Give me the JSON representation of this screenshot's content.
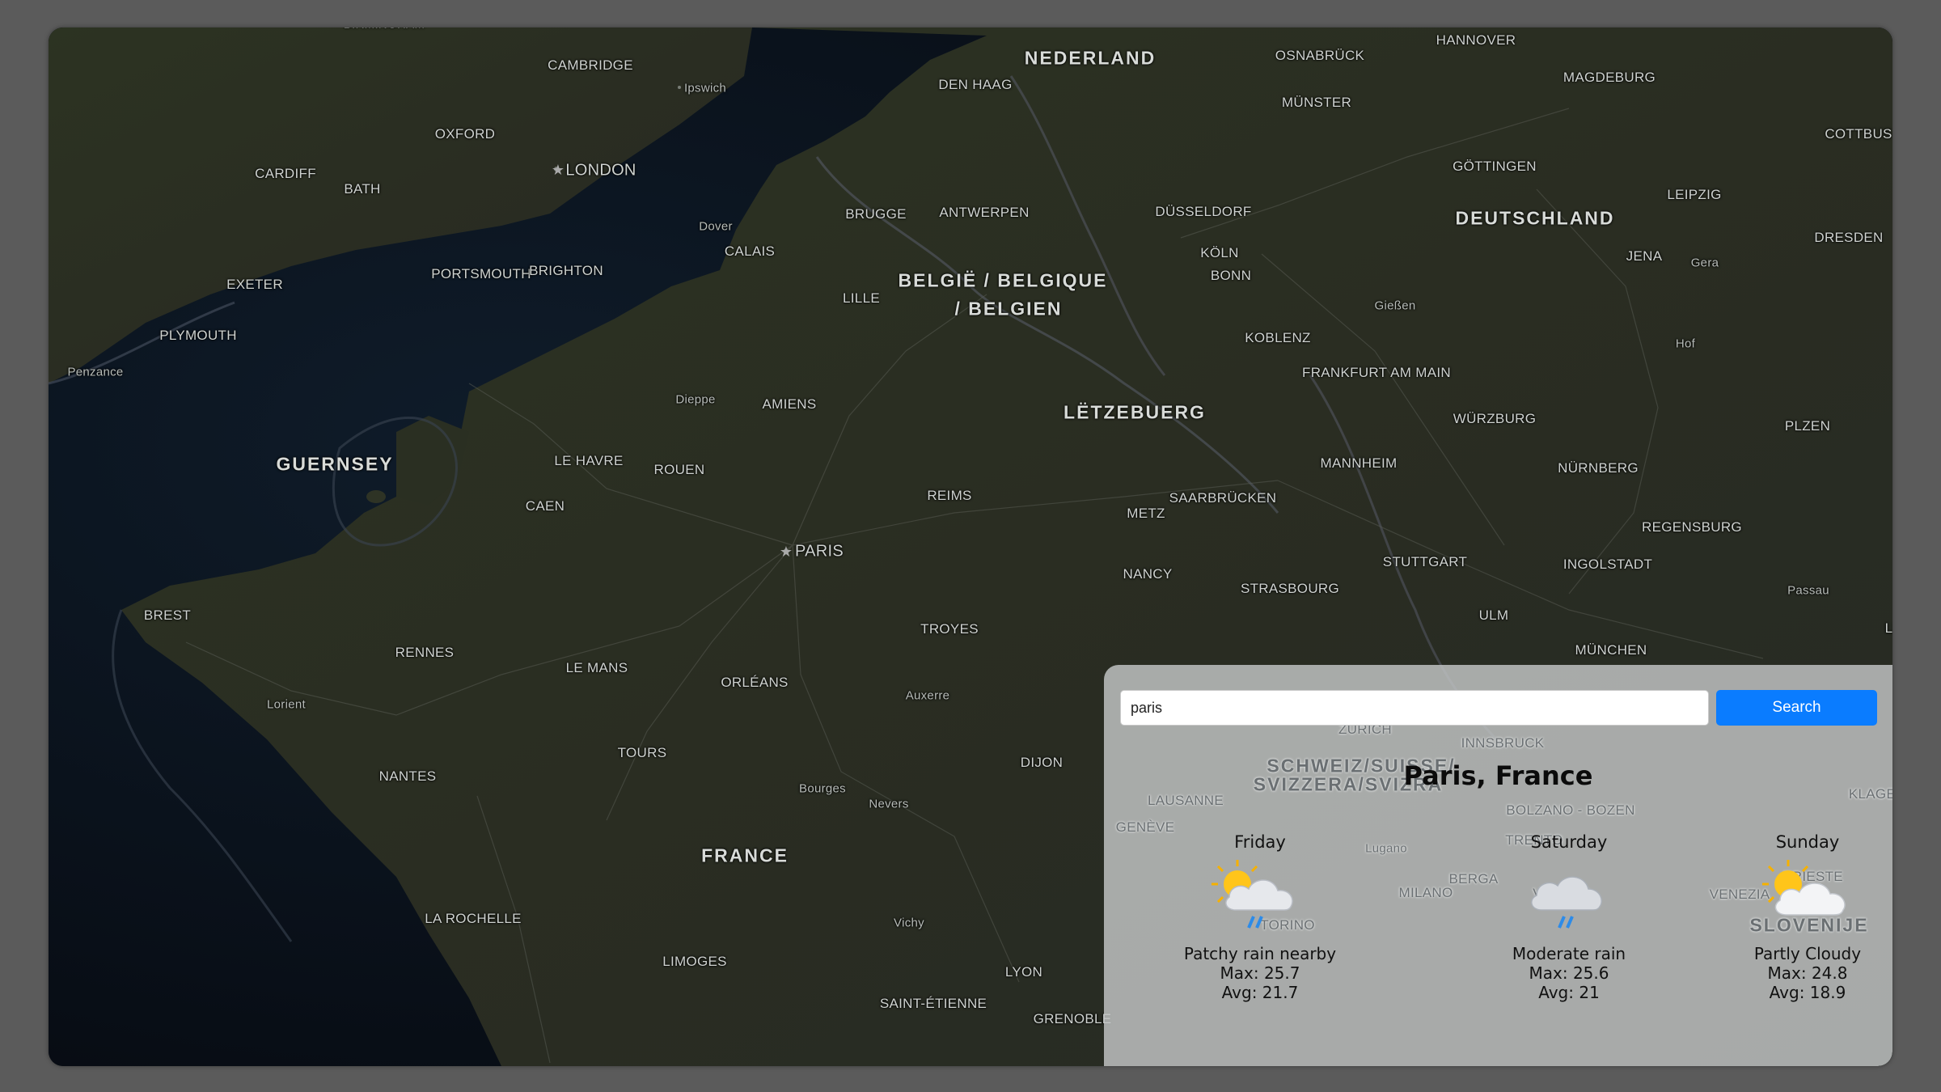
{
  "map": {
    "labels": [
      {
        "text": "BIRMINGHAM",
        "kind": "small"
      },
      {
        "text": "CAMBRIDGE",
        "kind": "city"
      },
      {
        "text": "Ipswich",
        "kind": "small"
      },
      {
        "text": "OXFORD",
        "kind": "city"
      },
      {
        "text": "LONDON",
        "kind": "big"
      },
      {
        "text": "CARDIFF",
        "kind": "city"
      },
      {
        "text": "BATH",
        "kind": "city"
      },
      {
        "text": "Dover",
        "kind": "small"
      },
      {
        "text": "EXETER",
        "kind": "city"
      },
      {
        "text": "PORTSMOUTH",
        "kind": "city"
      },
      {
        "text": "BRIGHTON",
        "kind": "city"
      },
      {
        "text": "PLYMOUTH",
        "kind": "city"
      },
      {
        "text": "Penzance",
        "kind": "small"
      },
      {
        "text": "CALAIS",
        "kind": "city"
      },
      {
        "text": "BRUGGE",
        "kind": "city"
      },
      {
        "text": "ANTWERPEN",
        "kind": "city"
      },
      {
        "text": "DEN HAAG",
        "kind": "city"
      },
      {
        "text": "NEDERLAND",
        "kind": "country"
      },
      {
        "text": "OSNABRÜCK",
        "kind": "city"
      },
      {
        "text": "HANNOVER",
        "kind": "city"
      },
      {
        "text": "MAGDEBURG",
        "kind": "city"
      },
      {
        "text": "MÜNSTER",
        "kind": "city"
      },
      {
        "text": "COTTBUS",
        "kind": "city"
      },
      {
        "text": "GÖTTINGEN",
        "kind": "city"
      },
      {
        "text": "LEIPZIG",
        "kind": "city"
      },
      {
        "text": "DÜSSELDORF",
        "kind": "city"
      },
      {
        "text": "DEUTSCHLAND",
        "kind": "country"
      },
      {
        "text": "DRESDEN",
        "kind": "city"
      },
      {
        "text": "KÖLN",
        "kind": "city"
      },
      {
        "text": "BONN",
        "kind": "city"
      },
      {
        "text": "JENA",
        "kind": "city"
      },
      {
        "text": "Gera",
        "kind": "small"
      },
      {
        "text": "BELGIË / BELGIQUE",
        "kind": "country"
      },
      {
        "text": "/ BELGIEN",
        "kind": "country"
      },
      {
        "text": "LILLE",
        "kind": "city"
      },
      {
        "text": "Gießen",
        "kind": "small"
      },
      {
        "text": "KOBLENZ",
        "kind": "city"
      },
      {
        "text": "Hof",
        "kind": "small"
      },
      {
        "text": "FRANKFURT AM MAIN",
        "kind": "city"
      },
      {
        "text": "Dieppe",
        "kind": "small"
      },
      {
        "text": "AMIENS",
        "kind": "city"
      },
      {
        "text": "LËTZEBUERG",
        "kind": "country"
      },
      {
        "text": "WÜRZBURG",
        "kind": "city"
      },
      {
        "text": "PLZEN",
        "kind": "city"
      },
      {
        "text": "GUERNSEY",
        "kind": "country"
      },
      {
        "text": "LE HAVRE",
        "kind": "city"
      },
      {
        "text": "ROUEN",
        "kind": "city"
      },
      {
        "text": "MANNHEIM",
        "kind": "city"
      },
      {
        "text": "NÜRNBERG",
        "kind": "city"
      },
      {
        "text": "CAEN",
        "kind": "city"
      },
      {
        "text": "REIMS",
        "kind": "city"
      },
      {
        "text": "SAARBRÜCKEN",
        "kind": "city"
      },
      {
        "text": "METZ",
        "kind": "city"
      },
      {
        "text": "REGENSBURG",
        "kind": "city"
      },
      {
        "text": "PARIS",
        "kind": "big"
      },
      {
        "text": "STUTTGART",
        "kind": "city"
      },
      {
        "text": "INGOLSTADT",
        "kind": "city"
      },
      {
        "text": "NANCY",
        "kind": "city"
      },
      {
        "text": "STRASBOURG",
        "kind": "city"
      },
      {
        "text": "Passau",
        "kind": "small"
      },
      {
        "text": "BREST",
        "kind": "city"
      },
      {
        "text": "ULM",
        "kind": "city"
      },
      {
        "text": "TROYES",
        "kind": "city"
      },
      {
        "text": "RENNES",
        "kind": "city"
      },
      {
        "text": "MÜNCHEN",
        "kind": "city"
      },
      {
        "text": "LI",
        "kind": "city"
      },
      {
        "text": "LE MANS",
        "kind": "city"
      },
      {
        "text": "ORLÉANS",
        "kind": "city"
      },
      {
        "text": "Auxerre",
        "kind": "small"
      },
      {
        "text": "Lorient",
        "kind": "small"
      },
      {
        "text": "TOURS",
        "kind": "city"
      },
      {
        "text": "DIJON",
        "kind": "city"
      },
      {
        "text": "NANTES",
        "kind": "city"
      },
      {
        "text": "Bourges",
        "kind": "small"
      },
      {
        "text": "Nevers",
        "kind": "small"
      },
      {
        "text": "FRANCE",
        "kind": "country"
      },
      {
        "text": "LA ROCHELLE",
        "kind": "city"
      },
      {
        "text": "Vichy",
        "kind": "small"
      },
      {
        "text": "LIMOGES",
        "kind": "city"
      },
      {
        "text": "LYON",
        "kind": "city"
      },
      {
        "text": "SAINT-ÉTIENNE",
        "kind": "city"
      },
      {
        "text": "GRENOBLE",
        "kind": "city"
      }
    ],
    "panel_labels": [
      {
        "text": "ZÜRICH",
        "kind": "city"
      },
      {
        "text": "INNSBRUCK",
        "kind": "city"
      },
      {
        "text": "SCHWEIZ/SUISSE/",
        "kind": "country"
      },
      {
        "text": "SVIZZERA/SVIZRA",
        "kind": "country"
      },
      {
        "text": "LAUSANNE",
        "kind": "city"
      },
      {
        "text": "GENÈVE",
        "kind": "city"
      },
      {
        "text": "BOLZANO - BOZEN",
        "kind": "city"
      },
      {
        "text": "KLAGE",
        "kind": "city"
      },
      {
        "text": "TRENTO",
        "kind": "city"
      },
      {
        "text": "Lugano",
        "kind": "small"
      },
      {
        "text": "BERGA",
        "kind": "city"
      },
      {
        "text": "MILANO",
        "kind": "city"
      },
      {
        "text": "VERONA",
        "kind": "city"
      },
      {
        "text": "VENEZIA",
        "kind": "city"
      },
      {
        "text": "TRIESTE",
        "kind": "city"
      },
      {
        "text": "TORINO",
        "kind": "city"
      },
      {
        "text": "SLOVENIJE",
        "kind": "country"
      }
    ]
  },
  "search": {
    "value": "paris",
    "button_label": "Search"
  },
  "weather": {
    "location": "Paris, France",
    "forecast": [
      {
        "day": "Friday",
        "icon": "patchy-rain-icon",
        "condition": "Patchy rain nearby",
        "max": "Max: 25.7",
        "avg": "Avg: 21.7"
      },
      {
        "day": "Saturday",
        "icon": "moderate-rain-icon",
        "condition": "Moderate rain",
        "max": "Max: 25.6",
        "avg": "Avg: 21"
      },
      {
        "day": "Sunday",
        "icon": "partly-cloudy-icon",
        "condition": "Partly Cloudy",
        "max": "Max: 24.8",
        "avg": "Avg: 18.9"
      }
    ]
  },
  "colors": {
    "background": "#5b5b5b",
    "search_button": "#0a7cff",
    "panel": "#c4c7c7"
  }
}
